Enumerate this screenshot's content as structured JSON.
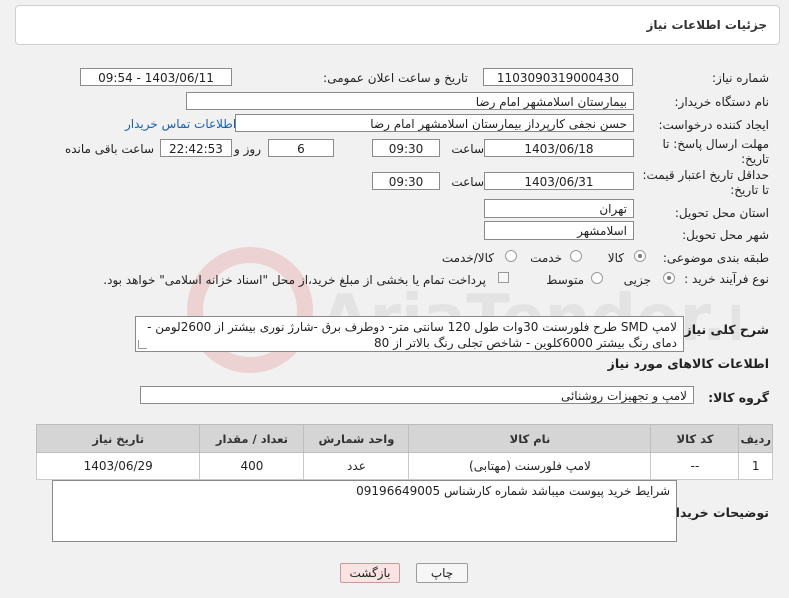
{
  "header": {
    "title": "جزئیات اطلاعات نیاز"
  },
  "form": {
    "need_number_label": "شماره نیاز:",
    "need_number": "1103090319000430",
    "announce_label": "تاریخ و ساعت اعلان عمومی:",
    "announce_value": "1403/06/11 - 09:54",
    "buyer_org_label": "نام دستگاه خریدار:",
    "buyer_org": "بیمارستان اسلامشهر   امام رضا",
    "creator_label": "ایجاد کننده درخواست:",
    "creator": "حسن نجفی کارپرداز بیمارستان اسلامشهر   امام رضا",
    "contact_link": "اطلاعات تماس خریدار",
    "reply_deadline_label": "مهلت ارسال پاسخ: تا تاریخ:",
    "reply_date": "1403/06/18",
    "time_label": "ساعت",
    "reply_time": "09:30",
    "days_count": "6",
    "days_label": "روز و",
    "remaining_time": "22:42:53",
    "remaining_label": "ساعت باقی مانده",
    "validity_label": "حداقل تاریخ اعتبار قیمت: تا تاریخ:",
    "validity_date": "1403/06/31",
    "validity_time": "09:30",
    "province_label": "استان محل تحویل:",
    "province": "تهران",
    "city_label": "شهر محل تحویل:",
    "city": "اسلامشهر",
    "category_label": "طبقه بندی موضوعی:",
    "category_options": [
      "کالا",
      "خدمت",
      "کالا/خدمت"
    ],
    "process_label": "نوع فرآیند خرید :",
    "process_options": [
      "جزیی",
      "متوسط"
    ],
    "payment_note": "پرداخت تمام یا بخشی از مبلغ خرید،از محل \"اسناد خزانه اسلامی\" خواهد بود.",
    "description_label": "شرح کلی نیاز:",
    "description": "لامپ SMD طرح فلورسنت 30وات طول 120 سانتی متر- دوطرف برق -شارژ نوری بیشتر از 2600لومن - دمای رنگ بیشتر 6000کلوین - شاخص تجلی رنگ بالاتر از 80"
  },
  "goods": {
    "section_title": "اطلاعات کالاهای مورد نیاز",
    "group_label": "گروه کالا:",
    "group_value": "لامپ و تجهیزات روشنائی",
    "columns": [
      "ردیف",
      "کد کالا",
      "نام کالا",
      "واحد شمارش",
      "تعداد / مقدار",
      "تاریخ نیاز"
    ],
    "rows": [
      [
        "1",
        "--",
        "لامپ فلورسنت (مهتابی)",
        "عدد",
        "400",
        "1403/06/29"
      ]
    ]
  },
  "buyer_notes": {
    "label": "توضیحات خریدار:",
    "text": "شرایط خرید پیوست میباشد شماره کارشناس 09196649005"
  },
  "buttons": {
    "print": "چاپ",
    "back": "بازگشت"
  },
  "watermark": {
    "text": "AriaTender.neT"
  }
}
